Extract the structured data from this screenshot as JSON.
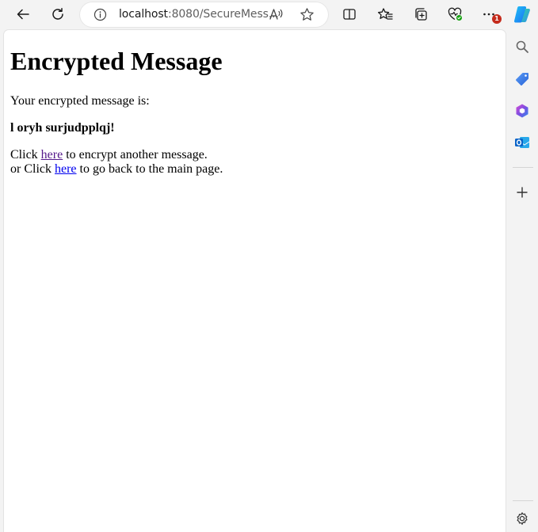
{
  "browser": {
    "url_host": "localhost",
    "url_rest": ":8080/SecureMess...",
    "notification_count": "1"
  },
  "page": {
    "heading": "Encrypted Message",
    "intro": "Your encrypted message is:",
    "ciphertext": "l oryh surjudpplqj!",
    "line1_prefix": "Click ",
    "line1_link": "here",
    "line1_suffix": " to encrypt another message.",
    "line2_prefix": "or Click ",
    "line2_link": "here",
    "line2_suffix": " to go back to the main page."
  },
  "colors": {
    "link": "#0000ee",
    "visited_link": "#551a8b",
    "notification_badge": "#c42b1c"
  },
  "icons": {
    "toolbar": [
      "back-icon",
      "refresh-icon",
      "info-icon",
      "read-aloud-icon",
      "favorite-star-icon",
      "split-screen-icon",
      "favorites-icon",
      "collections-icon",
      "browser-essentials-icon",
      "more-icon",
      "copilot-icon"
    ],
    "sidebar": [
      "search-icon",
      "shopping-tag-icon",
      "office-icon",
      "outlook-icon",
      "add-icon",
      "settings-icon"
    ]
  }
}
